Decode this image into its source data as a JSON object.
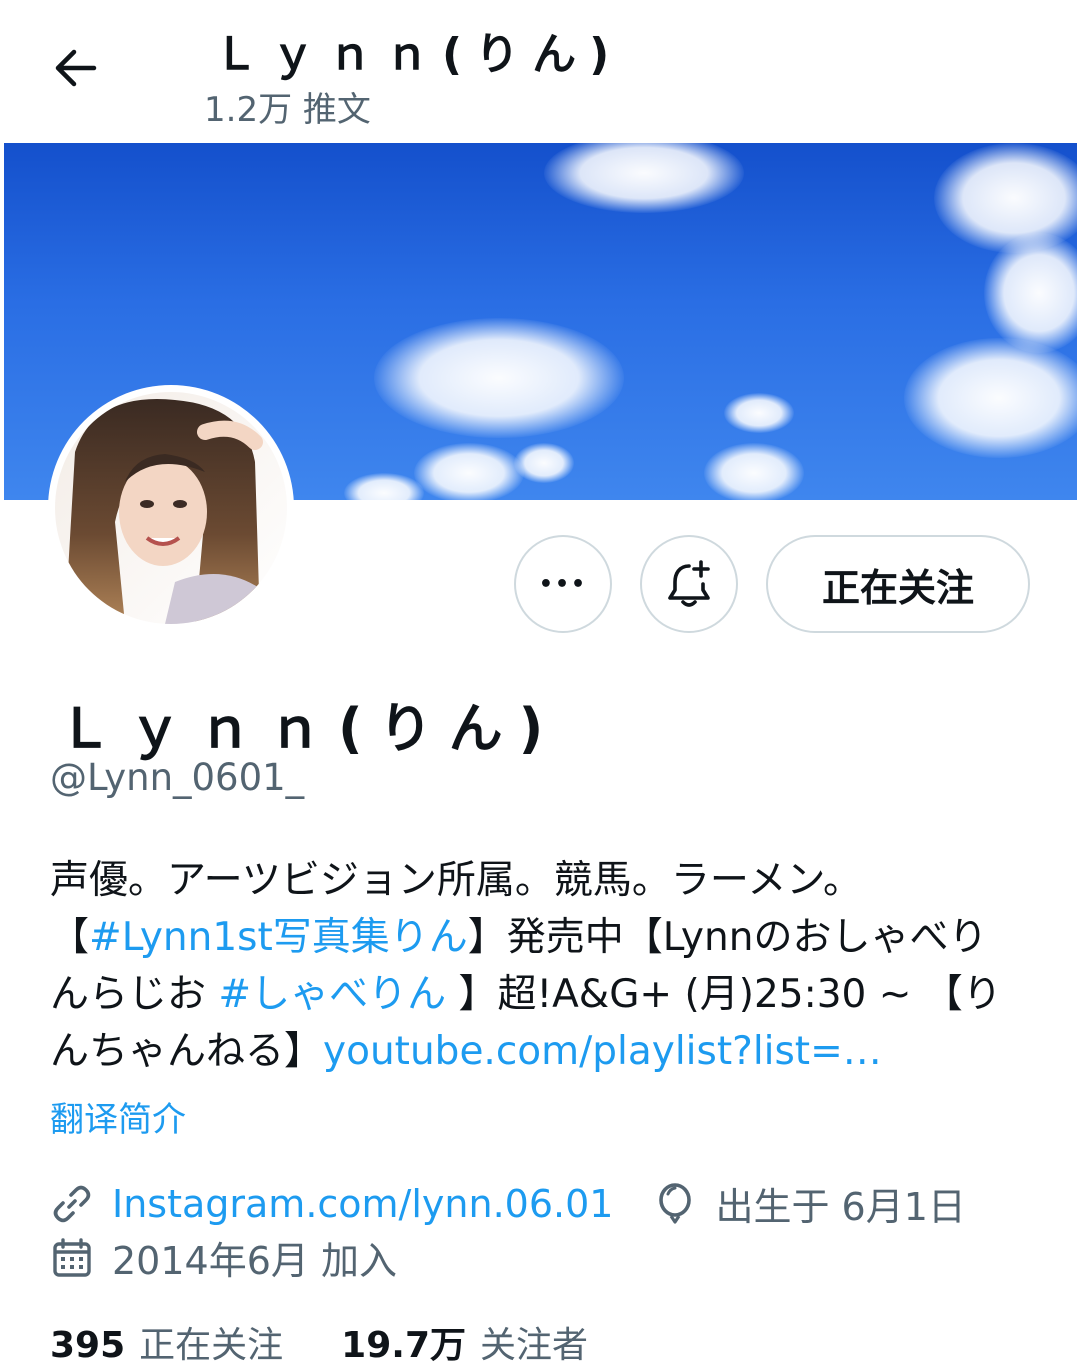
{
  "header": {
    "title": "Ｌｙｎｎ(りん)",
    "tweet_count": "1.2万 推文"
  },
  "actions": {
    "more_label": "•••",
    "follow_label": "正在关注"
  },
  "profile": {
    "display_name": "Ｌｙｎｎ(りん)",
    "handle": "@Lynn_0601_",
    "bio": {
      "line1": "声優。アーツビジョン所属。競馬。ラーメン。",
      "line2_a": "【",
      "line2_link": "#Lynn1st写真集りん",
      "line2_b": "】発売中【Lynnのおしゃべり",
      "line3_a": "んらじお ",
      "line3_link": "#しゃべりん",
      "line3_b": " 】超!A&G+ (月)25:30 ~ 【り",
      "line4_a": "んちゃんねる】",
      "line4_link": "youtube.com/playlist?list=…"
    },
    "translate_label": "翻译简介",
    "website": "Instagram.com/lynn.06.01",
    "birthday": "出生于 6月1日",
    "joined": "2014年6月 加入"
  },
  "stats": {
    "following_count": "395",
    "following_label": "正在关注",
    "followers_count": "19.7万",
    "followers_label": "关注者"
  },
  "colors": {
    "link": "#1d9bf0",
    "secondary_text": "#536471",
    "border": "#cfd9de",
    "banner_sky": "#2a6ee4"
  }
}
